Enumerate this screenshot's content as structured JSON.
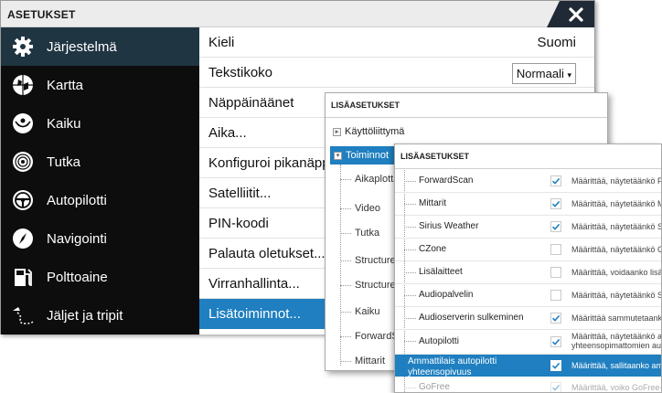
{
  "window": {
    "title": "ASETUKSET"
  },
  "sidebar": {
    "items": [
      {
        "label": "Järjestelmä",
        "icon": "gear-icon"
      },
      {
        "label": "Kartta",
        "icon": "chart-icon"
      },
      {
        "label": "Kaiku",
        "icon": "echo-icon"
      },
      {
        "label": "Tutka",
        "icon": "radar-icon"
      },
      {
        "label": "Autopilotti",
        "icon": "steering-wheel-icon"
      },
      {
        "label": "Navigointi",
        "icon": "compass-icon"
      },
      {
        "label": "Polttoaine",
        "icon": "fuel-pump-icon"
      },
      {
        "label": "Jäljet ja tripit",
        "icon": "trail-icon"
      }
    ],
    "selected_index": 0
  },
  "content": {
    "rows": [
      {
        "label": "Kieli",
        "value": "Suomi"
      },
      {
        "label": "Tekstikoko",
        "value": "Normaali"
      },
      {
        "label": "Näppäinäänet"
      },
      {
        "label": "Aika..."
      },
      {
        "label": "Konfiguroi pikanäppäin..."
      },
      {
        "label": "Satelliitit..."
      },
      {
        "label": "PIN-koodi"
      },
      {
        "label": "Palauta oletukset..."
      },
      {
        "label": "Virranhallinta..."
      },
      {
        "label": "Lisätoiminnot..."
      }
    ],
    "selected_index": 9
  },
  "advanced1": {
    "title": "LISÄASETUKSET",
    "root_item": "Käyttöliittymä",
    "selected_item": "Toiminnot",
    "children": [
      "Aikaplotta",
      "Video",
      "Tutka",
      "Structure",
      "StructureS",
      "Kaiku",
      "ForwardSc",
      "Mittarit"
    ]
  },
  "advanced2": {
    "title": "LISÄASETUKSET",
    "options": [
      {
        "name": "ForwardScan",
        "checked": true,
        "desc": "Määrittää, näytetäänkö ForwardScan"
      },
      {
        "name": "Mittarit",
        "checked": true,
        "desc": "Määrittää, näytetäänkö Mittarit"
      },
      {
        "name": "Sirius Weather",
        "checked": true,
        "desc": "Määrittää, näytetäänkö Sirius Weather"
      },
      {
        "name": "CZone",
        "checked": false,
        "desc": "Määrittää, näytetäänkö CZone"
      },
      {
        "name": "Lisälaitteet",
        "checked": false,
        "desc": "Määrittää, voidaanko lisälaitteet"
      },
      {
        "name": "Audiopalvelin",
        "checked": false,
        "desc": "Määrittää, näytetäänkö Sonic Hub"
      },
      {
        "name": "Audioserverin sulkeminen",
        "checked": true,
        "desc": "Määrittää sammutetaanko"
      },
      {
        "name": "Autopilotti",
        "checked": true,
        "desc": "Määrittää, näytetäänkö autopilotti",
        "desc2": "yhteensopimattomien autopilottien"
      },
      {
        "name": "Ammattilais autopilotti",
        "name2": "yhteensopivuus",
        "checked": true,
        "desc": "Määrittää, sallitaanko ammattilais"
      },
      {
        "name": "GoFree",
        "checked": true,
        "desc": "Määrittää, voiko GoFree-m"
      }
    ],
    "selected_index": 8
  }
}
